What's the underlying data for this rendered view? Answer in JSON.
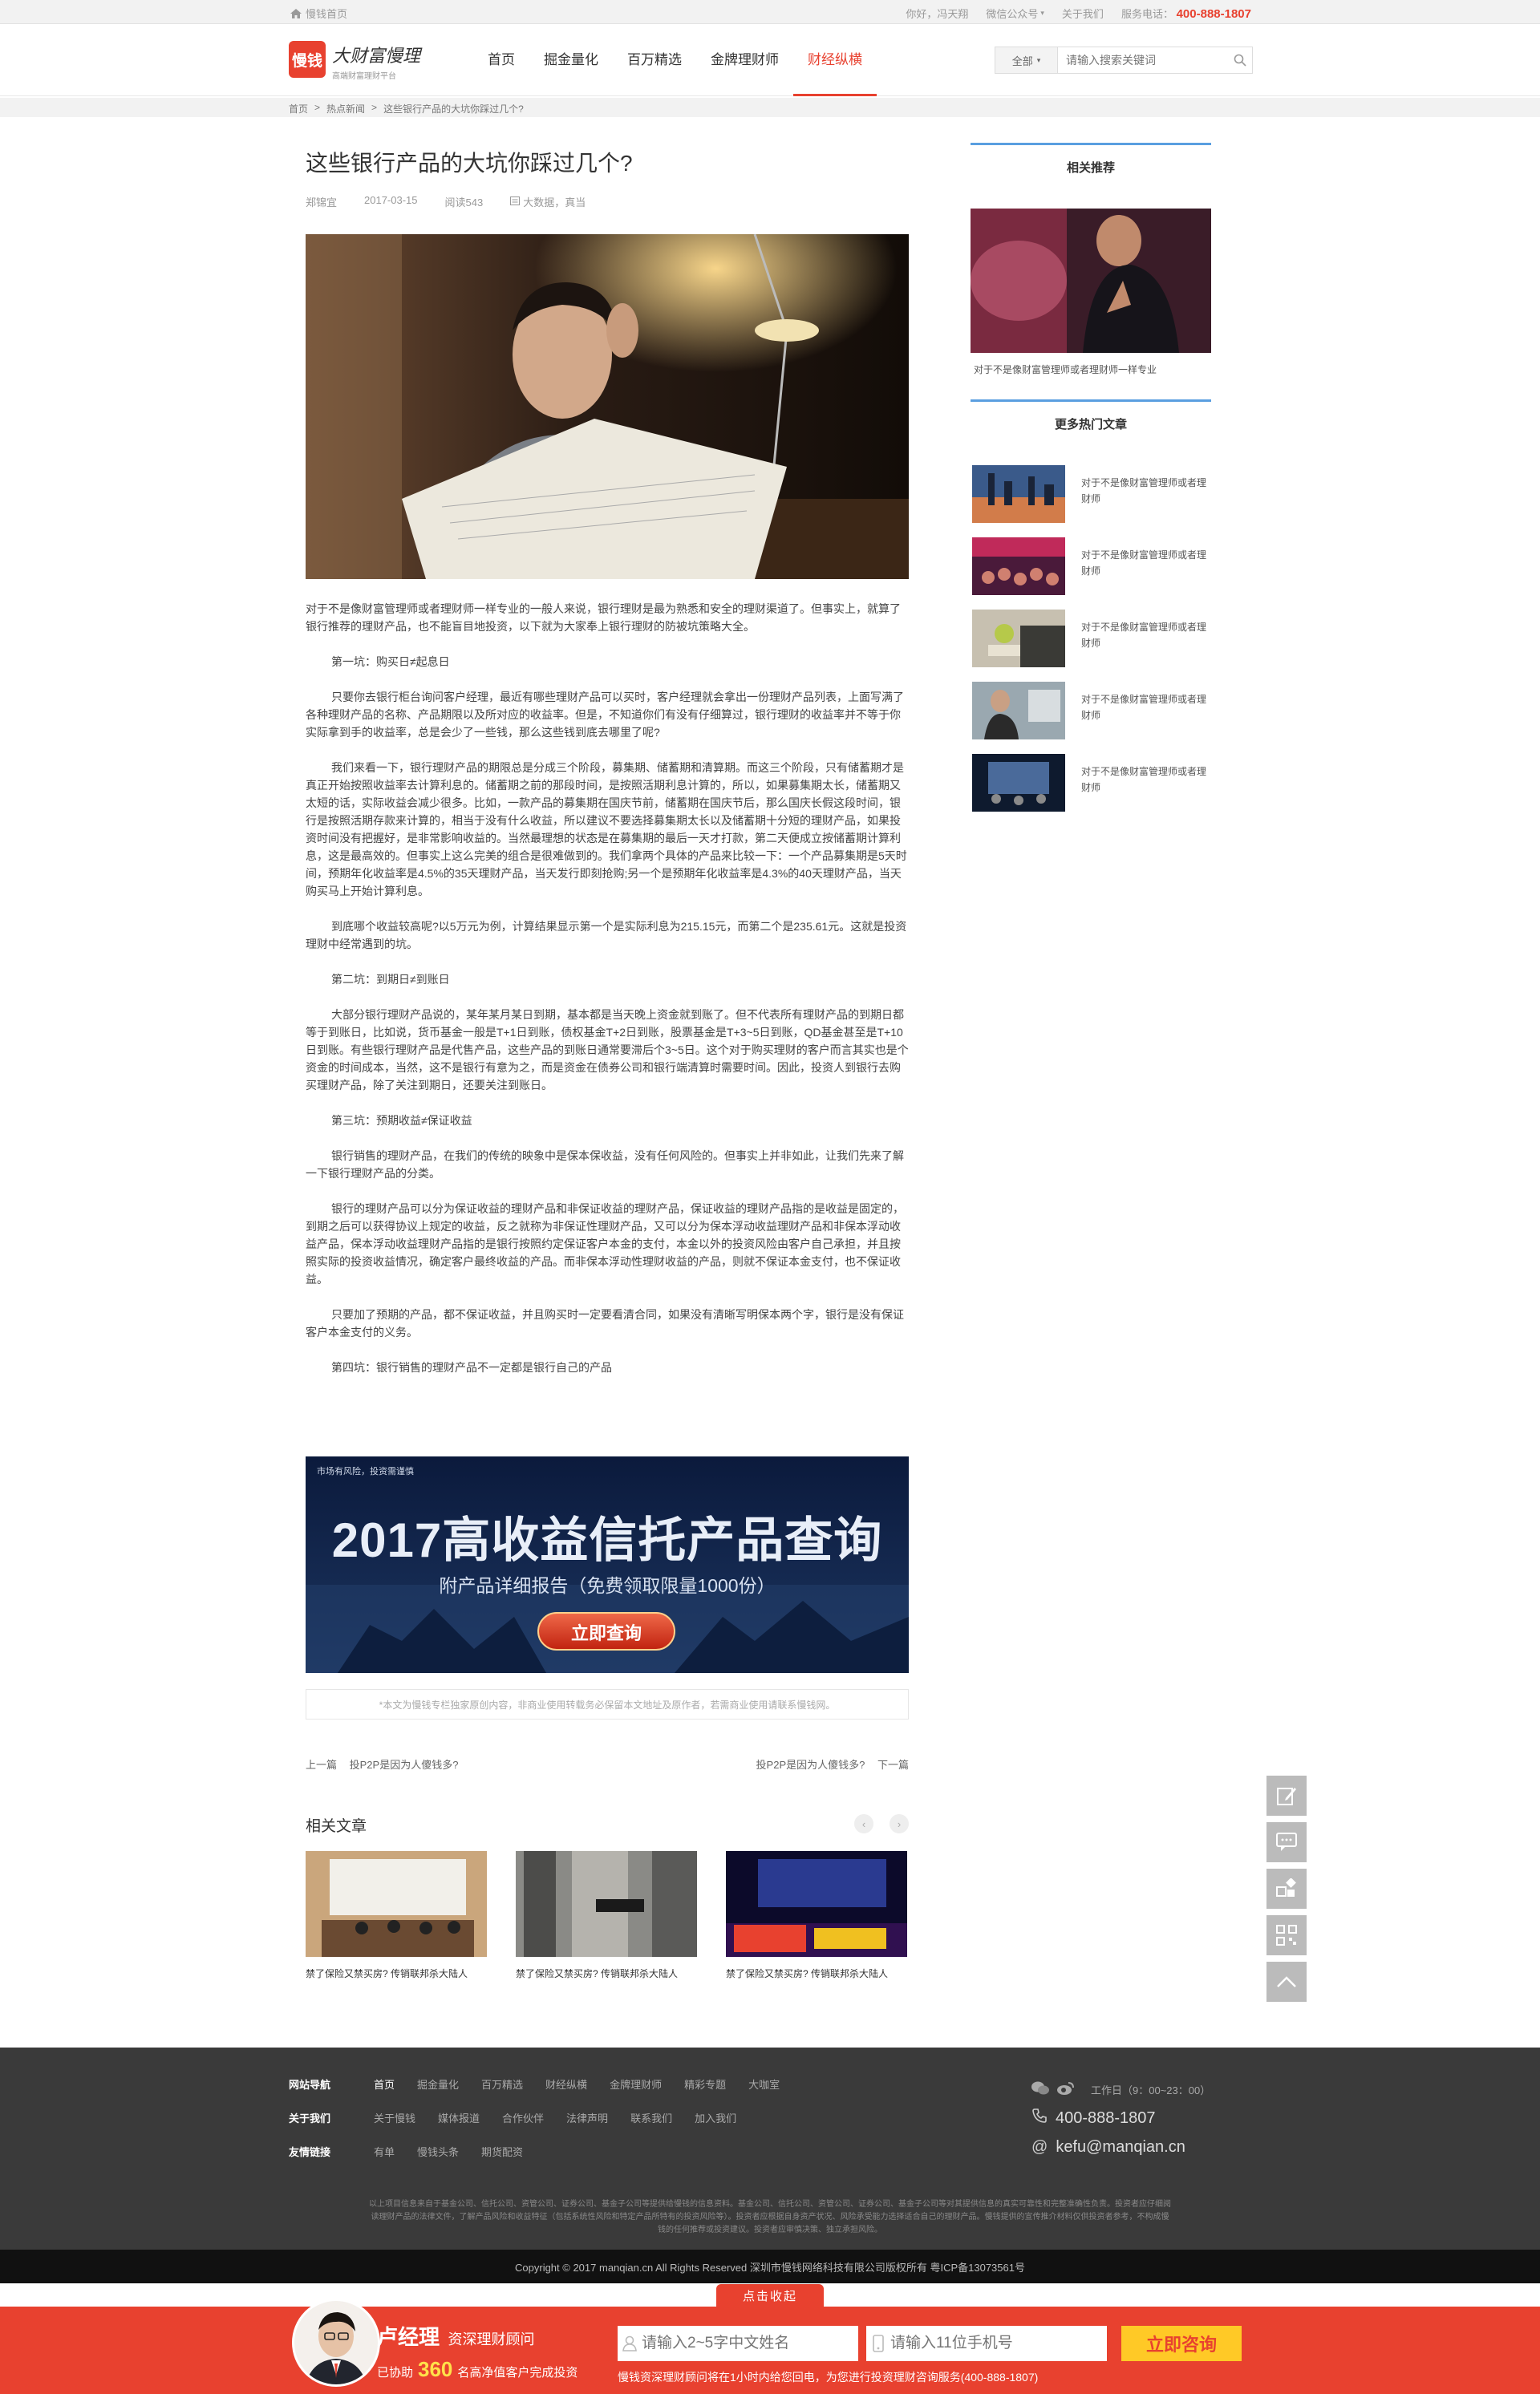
{
  "topbar": {
    "home": "慢钱首页",
    "greeting": "你好，冯天翔",
    "wechat": "微信公众号",
    "about": "关于我们",
    "service_label": "服务电话：",
    "service_phone": "400-888-1807"
  },
  "header": {
    "logo_mark": "慢钱",
    "logo_slogan": "大财富慢理",
    "logo_sub": "高端财富理财平台",
    "nav": [
      {
        "label": "首页"
      },
      {
        "label": "掘金量化"
      },
      {
        "label": "百万精选"
      },
      {
        "label": "金牌理财师"
      },
      {
        "label": "财经纵横"
      }
    ],
    "search_scope": "全部",
    "search_placeholder": "请输入搜索关键词"
  },
  "breadcrumb": [
    "首页",
    "热点新闻",
    "这些银行产品的大坑你踩过几个?"
  ],
  "article": {
    "title": "这些银行产品的大坑你踩过几个?",
    "author": "郑锦宜",
    "date": "2017-03-15",
    "reads": "阅读543",
    "tags": "大数据，真当",
    "paragraphs": [
      {
        "text": "对于不是像财富管理师或者理财师一样专业的一般人来说，银行理财是最为熟悉和安全的理财渠道了。但事实上，就算了银行推荐的理财产品，也不能盲目地投资，以下就为大家奉上银行理财的防被坑策略大全。",
        "indent": false
      },
      {
        "text": "第一坑：购买日≠起息日",
        "indent": true
      },
      {
        "text": "只要你去银行柜台询问客户经理，最近有哪些理财产品可以买时，客户经理就会拿出一份理财产品列表，上面写满了各种理财产品的名称、产品期限以及所对应的收益率。但是，不知道你们有没有仔细算过，银行理财的收益率并不等于你实际拿到手的收益率，总是会少了一些钱，那么这些钱到底去哪里了呢?",
        "indent": true
      },
      {
        "text": "我们来看一下，银行理财产品的期限总是分成三个阶段，募集期、储蓄期和清算期。而这三个阶段，只有储蓄期才是真正开始按照收益率去计算利息的。储蓄期之前的那段时间，是按照活期利息计算的，所以，如果募集期太长，储蓄期又太短的话，实际收益会减少很多。比如，一款产品的募集期在国庆节前，储蓄期在国庆节后，那么国庆长假这段时间，银行是按照活期存款来计算的，相当于没有什么收益，所以建议不要选择募集期太长以及储蓄期十分短的理财产品，如果投资时间没有把握好，是非常影响收益的。当然最理想的状态是在募集期的最后一天才打款，第二天便成立按储蓄期计算利息，这是最高效的。但事实上这么完美的组合是很难做到的。我们拿两个具体的产品来比较一下：一个产品募集期是5天时间，预期年化收益率是4.5%的35天理财产品，当天发行即刻抢购;另一个是预期年化收益率是4.3%的40天理财产品，当天购买马上开始计算利息。",
        "indent": true
      },
      {
        "text": "到底哪个收益较高呢?以5万元为例，计算结果显示第一个是实际利息为215.15元，而第二个是235.61元。这就是投资理财中经常遇到的坑。",
        "indent": true
      },
      {
        "text": "第二坑：到期日≠到账日",
        "indent": true
      },
      {
        "text": "大部分银行理财产品说的，某年某月某日到期，基本都是当天晚上资金就到账了。但不代表所有理财产品的到期日都等于到账日，比如说，货币基金一般是T+1日到账，债权基金T+2日到账，股票基金是T+3~5日到账，QD基金甚至是T+10日到账。有些银行理财产品是代售产品，这些产品的到账日通常要滞后个3~5日。这个对于购买理财的客户而言其实也是个资金的时间成本，当然，这不是银行有意为之，而是资金在债券公司和银行端清算时需要时间。因此，投资人到银行去购买理财产品，除了关注到期日，还要关注到账日。",
        "indent": true
      },
      {
        "text": "第三坑：预期收益≠保证收益",
        "indent": true
      },
      {
        "text": "银行销售的理财产品，在我们的传统的映象中是保本保收益，没有任何风险的。但事实上并非如此，让我们先来了解一下银行理财产品的分类。",
        "indent": true
      },
      {
        "text": "银行的理财产品可以分为保证收益的理财产品和非保证收益的理财产品，保证收益的理财产品指的是收益是固定的，到期之后可以获得协议上规定的收益，反之就称为非保证性理财产品，又可以分为保本浮动收益理财产品和非保本浮动收益产品，保本浮动收益理财产品指的是银行按照约定保证客户本金的支付，本金以外的投资风险由客户自己承担，并且按照实际的投资收益情况，确定客户最终收益的产品。而非保本浮动性理财收益的产品，则就不保证本金支付，也不保证收益。",
        "indent": true
      },
      {
        "text": "只要加了预期的产品，都不保证收益，并且购买时一定要看清合同，如果没有清晰写明保本两个字，银行是没有保证客户本金支付的义务。",
        "indent": true
      },
      {
        "text": "第四坑：银行销售的理财产品不一定都是银行自己的产品",
        "indent": true
      }
    ],
    "ad": {
      "risk": "市场有风险，投资需谨慎",
      "headline": "2017高收益信托产品查询",
      "subline": "附产品详细报告（免费领取限量1000份）",
      "button": "立即查询"
    },
    "copyright_note": "*本文为慢钱专栏独家原创内容，非商业使用转载务必保留本文地址及原作者，若需商业使用请联系慢钱网。",
    "prev_label": "上一篇",
    "prev_title": "投P2P是因为人傻钱多?",
    "next_title": "投P2P是因为人傻钱多?",
    "next_label": "下一篇",
    "related_title": "相关文章",
    "related": [
      {
        "caption": "禁了保险又禁买房? 传销联邦杀大陆人"
      },
      {
        "caption": "禁了保险又禁买房? 传销联邦杀大陆人"
      },
      {
        "caption": "禁了保险又禁买房? 传销联邦杀大陆人"
      }
    ]
  },
  "sidebar": {
    "recommend_title": "相关推荐",
    "featured_caption": "对于不是像财富管理师或者理财师一样专业",
    "hot_title": "更多热门文章",
    "hot": [
      {
        "title": "对于不是像财富管理师或者理财师"
      },
      {
        "title": "对于不是像财富管理师或者理财师"
      },
      {
        "title": "对于不是像财富管理师或者理财师"
      },
      {
        "title": "对于不是像财富管理师或者理财师"
      },
      {
        "title": "对于不是像财富管理师或者理财师"
      }
    ]
  },
  "footer": {
    "nav_label": "网站导航",
    "nav_links": [
      "首页",
      "掘金量化",
      "百万精选",
      "财经纵横",
      "金牌理财师",
      "精彩专题",
      "大咖室"
    ],
    "about_label": "关于我们",
    "about_links": [
      "关于慢钱",
      "媒体报道",
      "合作伙伴",
      "法律声明",
      "联系我们",
      "加入我们"
    ],
    "friend_label": "友情链接",
    "friend_links": [
      "有单",
      "慢钱头条",
      "期货配资"
    ],
    "hours": "工作日（9：00~23：00）",
    "phone": "400-888-1807",
    "email": "kefu@manqian.cn",
    "disclaimer": "以上项目信息来自于基金公司、信托公司、资管公司、证券公司、基金子公司等提供给慢钱的信息资料。基金公司、信托公司、资管公司、证券公司、基金子公司等对其提供信息的真实可靠性和完整准确性负责。投资者应仔细阅读理财产品的法律文件，了解产品风险和收益特征（包括系统性风险和特定产品所特有的投资风险等）。投资者应根据自身资产状况、风险承受能力选择适合自己的理财产品。慢钱提供的宣传推介材料仅供投资者参考，不构成慢钱的任何推荐或投资建议。投资者应审慎决策、独立承担风险。",
    "copyright": "Copyright © 2017 manqian.cn All Rights Reserved 深圳市慢钱网络科技有限公司版权所有 粤ICP备13073561号"
  },
  "consult": {
    "collapse": "点击收起",
    "name": "卢经理",
    "title": "资深理财顾问",
    "helped_prefix": "已协助",
    "helped_count": "360",
    "helped_suffix": "名高净值客户完成投资",
    "name_placeholder": "请输入2~5字中文姓名",
    "phone_placeholder": "请输入11位手机号",
    "button": "立即咨询",
    "note": "慢钱资深理财顾问将在1小时内给您回电，为您进行投资理财咨询服务(400-888-1807)"
  },
  "colors": {
    "brand": "#e8412f",
    "accent_blue": "#5a9fe0",
    "footer_bg": "#3a3a3a"
  }
}
